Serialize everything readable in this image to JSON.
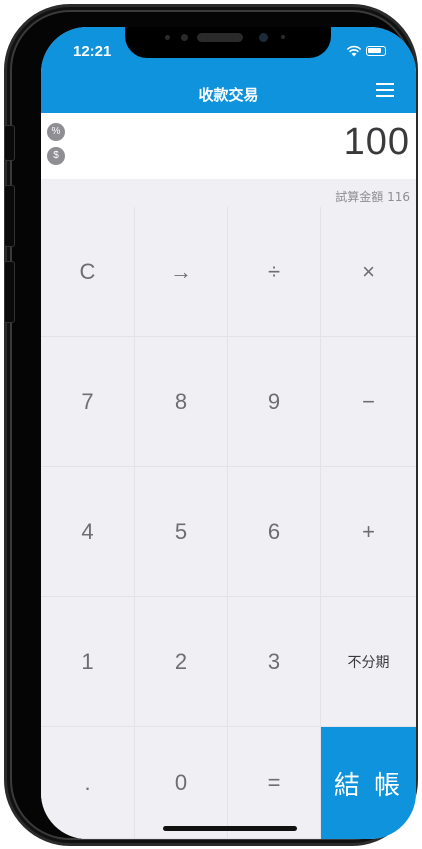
{
  "status_bar": {
    "time": "12:21"
  },
  "nav": {
    "title": "收款交易",
    "menu_icon": "hamburger-menu-icon"
  },
  "display": {
    "percent_chip": "%",
    "dollar_chip": "$",
    "amount": "100",
    "trial_label": "試算金額 116"
  },
  "keypad": {
    "row1": [
      "C",
      "→",
      "÷",
      "×"
    ],
    "row2": [
      "7",
      "8",
      "9",
      "−"
    ],
    "row3": [
      "4",
      "5",
      "6",
      "+"
    ],
    "row4": [
      "1",
      "2",
      "3",
      "不分期"
    ],
    "row5": [
      ".",
      "0",
      "=",
      "結 帳"
    ]
  },
  "colors": {
    "accent": "#0f93dc",
    "keypad_bg": "#efeff4",
    "key_text": "#6d6d72"
  }
}
